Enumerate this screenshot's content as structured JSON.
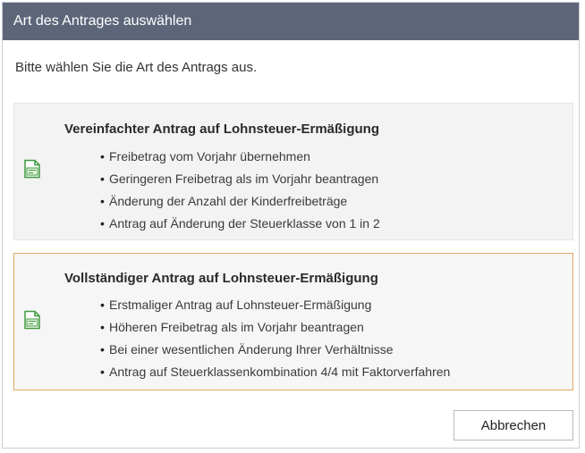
{
  "window": {
    "title": "Art des Antrages auswählen"
  },
  "prompt": "Bitte wählen Sie die Art des Antrags aus.",
  "options": [
    {
      "title": "Vereinfachter Antrag auf Lohnsteuer-Ermäßigung",
      "icon": "document-form-icon",
      "items": [
        "Freibetrag vom Vorjahr übernehmen",
        "Geringeren Freibetrag als im Vorjahr beantragen",
        "Änderung der Anzahl der Kinderfreibeträge",
        "Antrag auf Änderung der Steuerklasse von 1 in 2"
      ]
    },
    {
      "title": "Vollständiger Antrag auf Lohnsteuer-Ermäßigung",
      "icon": "document-form-icon",
      "items": [
        "Erstmaliger Antrag auf Lohnsteuer-Ermäßigung",
        "Höheren Freibetrag als im Vorjahr beantragen",
        "Bei einer wesentlichen Änderung Ihrer Verhältnisse",
        "Antrag auf Steuerklassenkombination 4/4 mit Faktorverfahren"
      ]
    }
  ],
  "buttons": {
    "cancel_label": "Abbrechen"
  },
  "colors": {
    "titlebar": "#5d6679",
    "selected_border": "#e5a764",
    "icon_green": "#3f9a3f"
  }
}
